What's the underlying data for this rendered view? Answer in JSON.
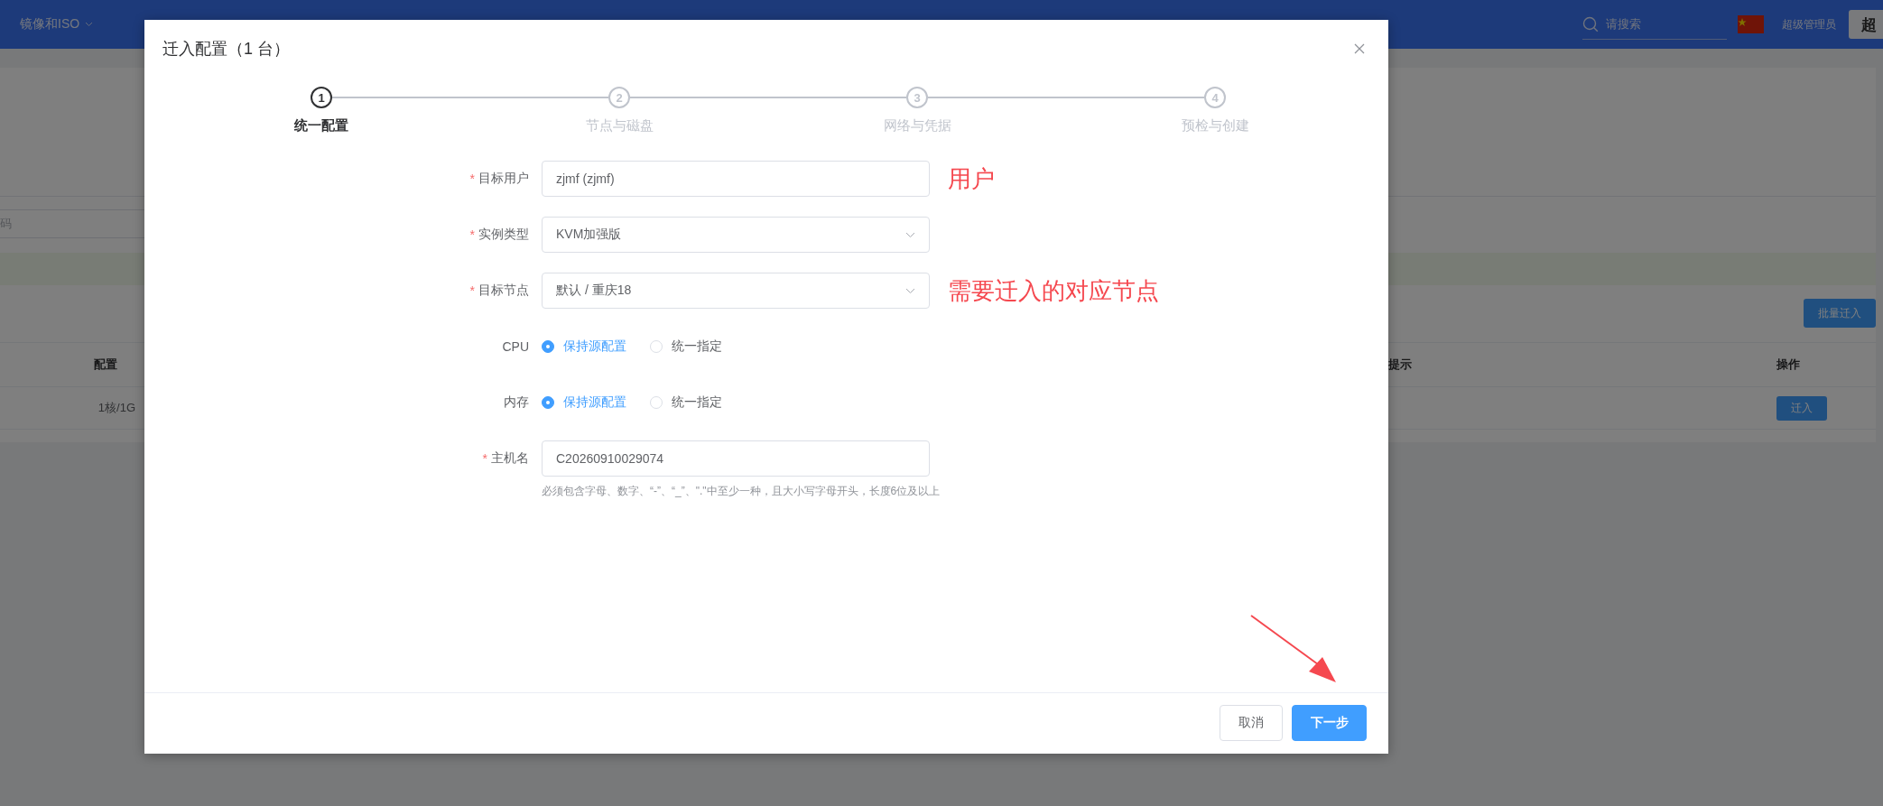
{
  "nav": {
    "items": [
      {
        "label": "镜像和ISO"
      }
    ],
    "search": {
      "placeholder": "请搜索"
    },
    "user": "超级管理员",
    "avatar": "超"
  },
  "page": {
    "search_fragment": "码",
    "batch_button": "批量迁入",
    "table": {
      "columns": [
        {
          "label": "配置"
        },
        {
          "label": "提示"
        },
        {
          "label": "操作"
        }
      ],
      "rows": [
        {
          "config": "1核/1G",
          "action": "迁入"
        }
      ]
    }
  },
  "dialog": {
    "title": "迁入配置（1 台）",
    "steps": [
      {
        "number": "1",
        "label": "统一配置",
        "selected": true
      },
      {
        "number": "2",
        "label": "节点与磁盘",
        "selected": false
      },
      {
        "number": "3",
        "label": "网络与凭据",
        "selected": false
      },
      {
        "number": "4",
        "label": "预检与创建",
        "selected": false
      }
    ],
    "fields": [
      {
        "kind": "input",
        "label": "目标用户",
        "required_mark": "*",
        "value": "zjmf (zjmf)",
        "annotation": "用户"
      },
      {
        "kind": "select",
        "label": "实例类型",
        "required_mark": "*",
        "value": "KVM加强版"
      },
      {
        "kind": "select",
        "label": "目标节点",
        "required_mark": "*",
        "value": "默认 / 重庆18",
        "annotation": "需要迁入的对应节点"
      },
      {
        "kind": "radio",
        "label": "CPU",
        "options": [
          {
            "label": "保持源配置",
            "selected": true
          },
          {
            "label": "统一指定",
            "selected": false
          }
        ]
      },
      {
        "kind": "radio",
        "label": "内存",
        "options": [
          {
            "label": "保持源配置",
            "selected": true
          },
          {
            "label": "统一指定",
            "selected": false
          }
        ]
      },
      {
        "kind": "input",
        "label": "主机名",
        "required_mark": "*",
        "value": "C20260910029074",
        "hint": "必须包含字母、数字、“-”、“_”、\".\"中至少一种，且大小写字母开头，长度6位及以上"
      }
    ],
    "buttons": [
      {
        "label": "取消",
        "kind": "secondary"
      },
      {
        "label": "下一步",
        "kind": "primary"
      }
    ]
  }
}
